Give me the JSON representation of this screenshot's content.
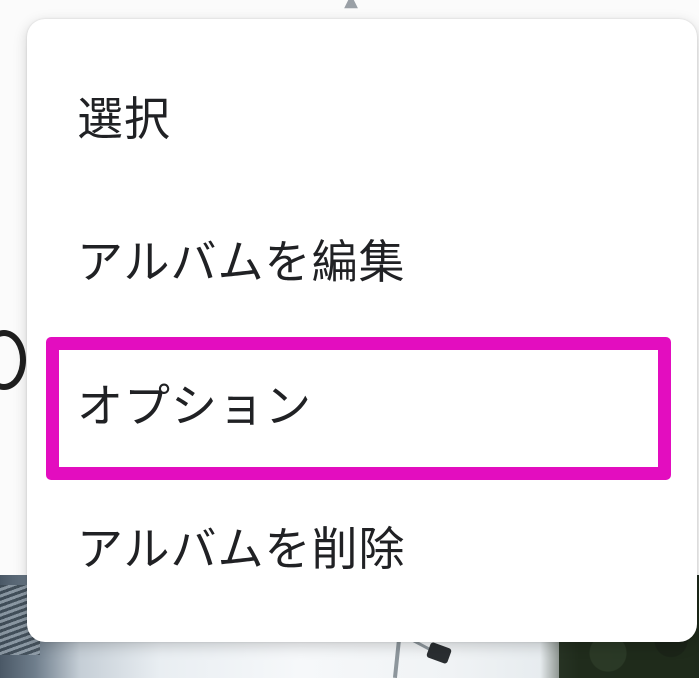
{
  "menu": {
    "items": [
      {
        "label": "選択"
      },
      {
        "label": "アルバムを編集"
      },
      {
        "label": "オプション"
      },
      {
        "label": "アルバムを削除"
      }
    ],
    "highlighted_item": "オプション"
  },
  "colors": {
    "highlight_border": "#e30dbf",
    "menu_background": "#ffffff",
    "menu_text": "#202124"
  }
}
